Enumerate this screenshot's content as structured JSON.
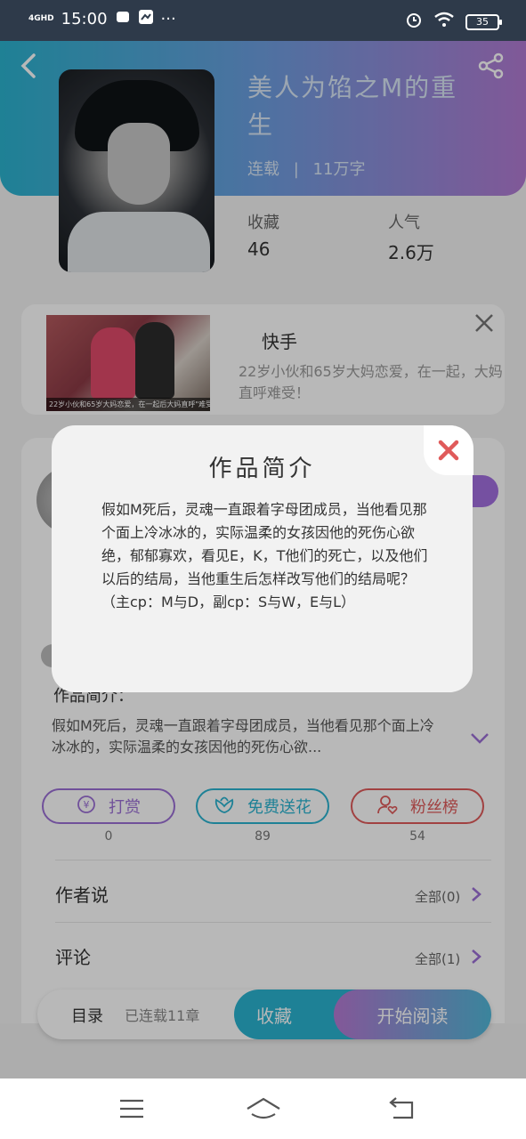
{
  "status_bar": {
    "signal": "4GHD",
    "time": "15:00",
    "more": "···",
    "battery": "35"
  },
  "book": {
    "title": "美人为馅之M的重生",
    "status": "连载",
    "separator": "|",
    "word_count": "11万字",
    "favorites_label": "收藏",
    "favorites_value": "46",
    "popularity_label": "人气",
    "popularity_value": "2.6万"
  },
  "ad": {
    "source": "快手",
    "description": "22岁小伙和65岁大妈恋爱，在一起，大妈直呼难受！",
    "image_caption": "22岁小伙和65岁大妈恋爱，在一起后大妈直呼\"难受\"！"
  },
  "info": {
    "intro_label": "作品简介：",
    "intro_text": "假如M死后，灵魂一直跟着字母团成员，当他看见那个面上冷冰冰的，实际温柔的女孩因他的死伤心欲...",
    "actions": [
      {
        "label": "打赏",
        "count": "0",
        "icon": "yen-icon",
        "color": "#9b6fd6"
      },
      {
        "label": "免费送花",
        "count": "89",
        "icon": "flower-icon",
        "color": "#2ab3d0"
      },
      {
        "label": "粉丝榜",
        "count": "54",
        "icon": "fan-icon",
        "color": "#e05a5a"
      }
    ],
    "author_says_label": "作者说",
    "author_says_more": "全部(0)",
    "comments_label": "评论",
    "comments_more": "全部(1)"
  },
  "bottom_bar": {
    "toc_label": "目录",
    "toc_status": "已连载11章",
    "favorite_button": "收藏",
    "read_button": "开始阅读"
  },
  "modal": {
    "title": "作品简介",
    "body": "假如M死后，灵魂一直跟着字母团成员，当他看见那个面上冷冰冰的，实际温柔的女孩因他的死伤心欲绝，郁郁寡欢，看见E，K，T他们的死亡，以及他们以后的结局，当他重生后怎样改写他们的结局呢？（主cp：M与D，副cp：S与W，E与L）"
  },
  "colors": {
    "header_start": "#2bb3cf",
    "header_end": "#b27bd3",
    "accent_blue": "#2ab3d0",
    "accent_purple": "#9b6fd6",
    "close_red": "#e05a5a"
  }
}
